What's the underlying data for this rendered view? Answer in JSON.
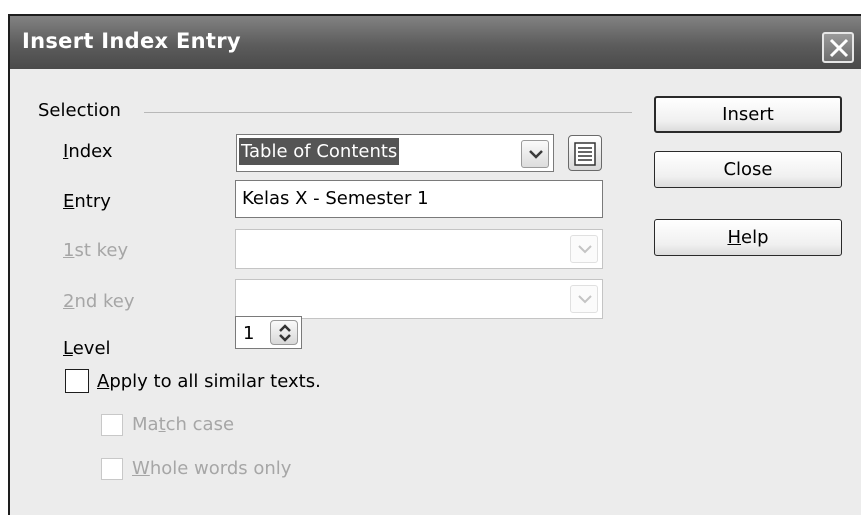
{
  "window": {
    "title": "Insert Index Entry"
  },
  "selection_group": {
    "label": "Selection"
  },
  "index": {
    "label_mnemonic": "I",
    "label_rest": "ndex",
    "value": "Table of Contents"
  },
  "entry": {
    "label_mnemonic": "E",
    "label_rest": "ntry",
    "value": "Kelas X - Semester 1"
  },
  "first_key": {
    "label_mnemonic": "1",
    "label_rest": "st key",
    "value": ""
  },
  "second_key": {
    "label_mnemonic": "2",
    "label_rest": "nd key",
    "value": ""
  },
  "level": {
    "label_mnemonic": "L",
    "label_rest": "evel",
    "value": "1"
  },
  "apply_all": {
    "label_mnemonic": "A",
    "label_rest": "pply to all similar texts.",
    "checked": false
  },
  "match_case": {
    "label_pre": "Ma",
    "label_mnemonic": "t",
    "label_rest": "ch case",
    "checked": false
  },
  "whole_words": {
    "label_mnemonic": "W",
    "label_rest": "hole words only",
    "checked": false
  },
  "buttons": {
    "insert": "Insert",
    "close": "Close",
    "help_mnemonic": "H",
    "help_rest": "elp"
  },
  "icons": {
    "close": "close-x-icon",
    "index_list": "index-list-icon",
    "dropdown": "chevron-down-icon",
    "spin": "spin-up-down-icon"
  }
}
